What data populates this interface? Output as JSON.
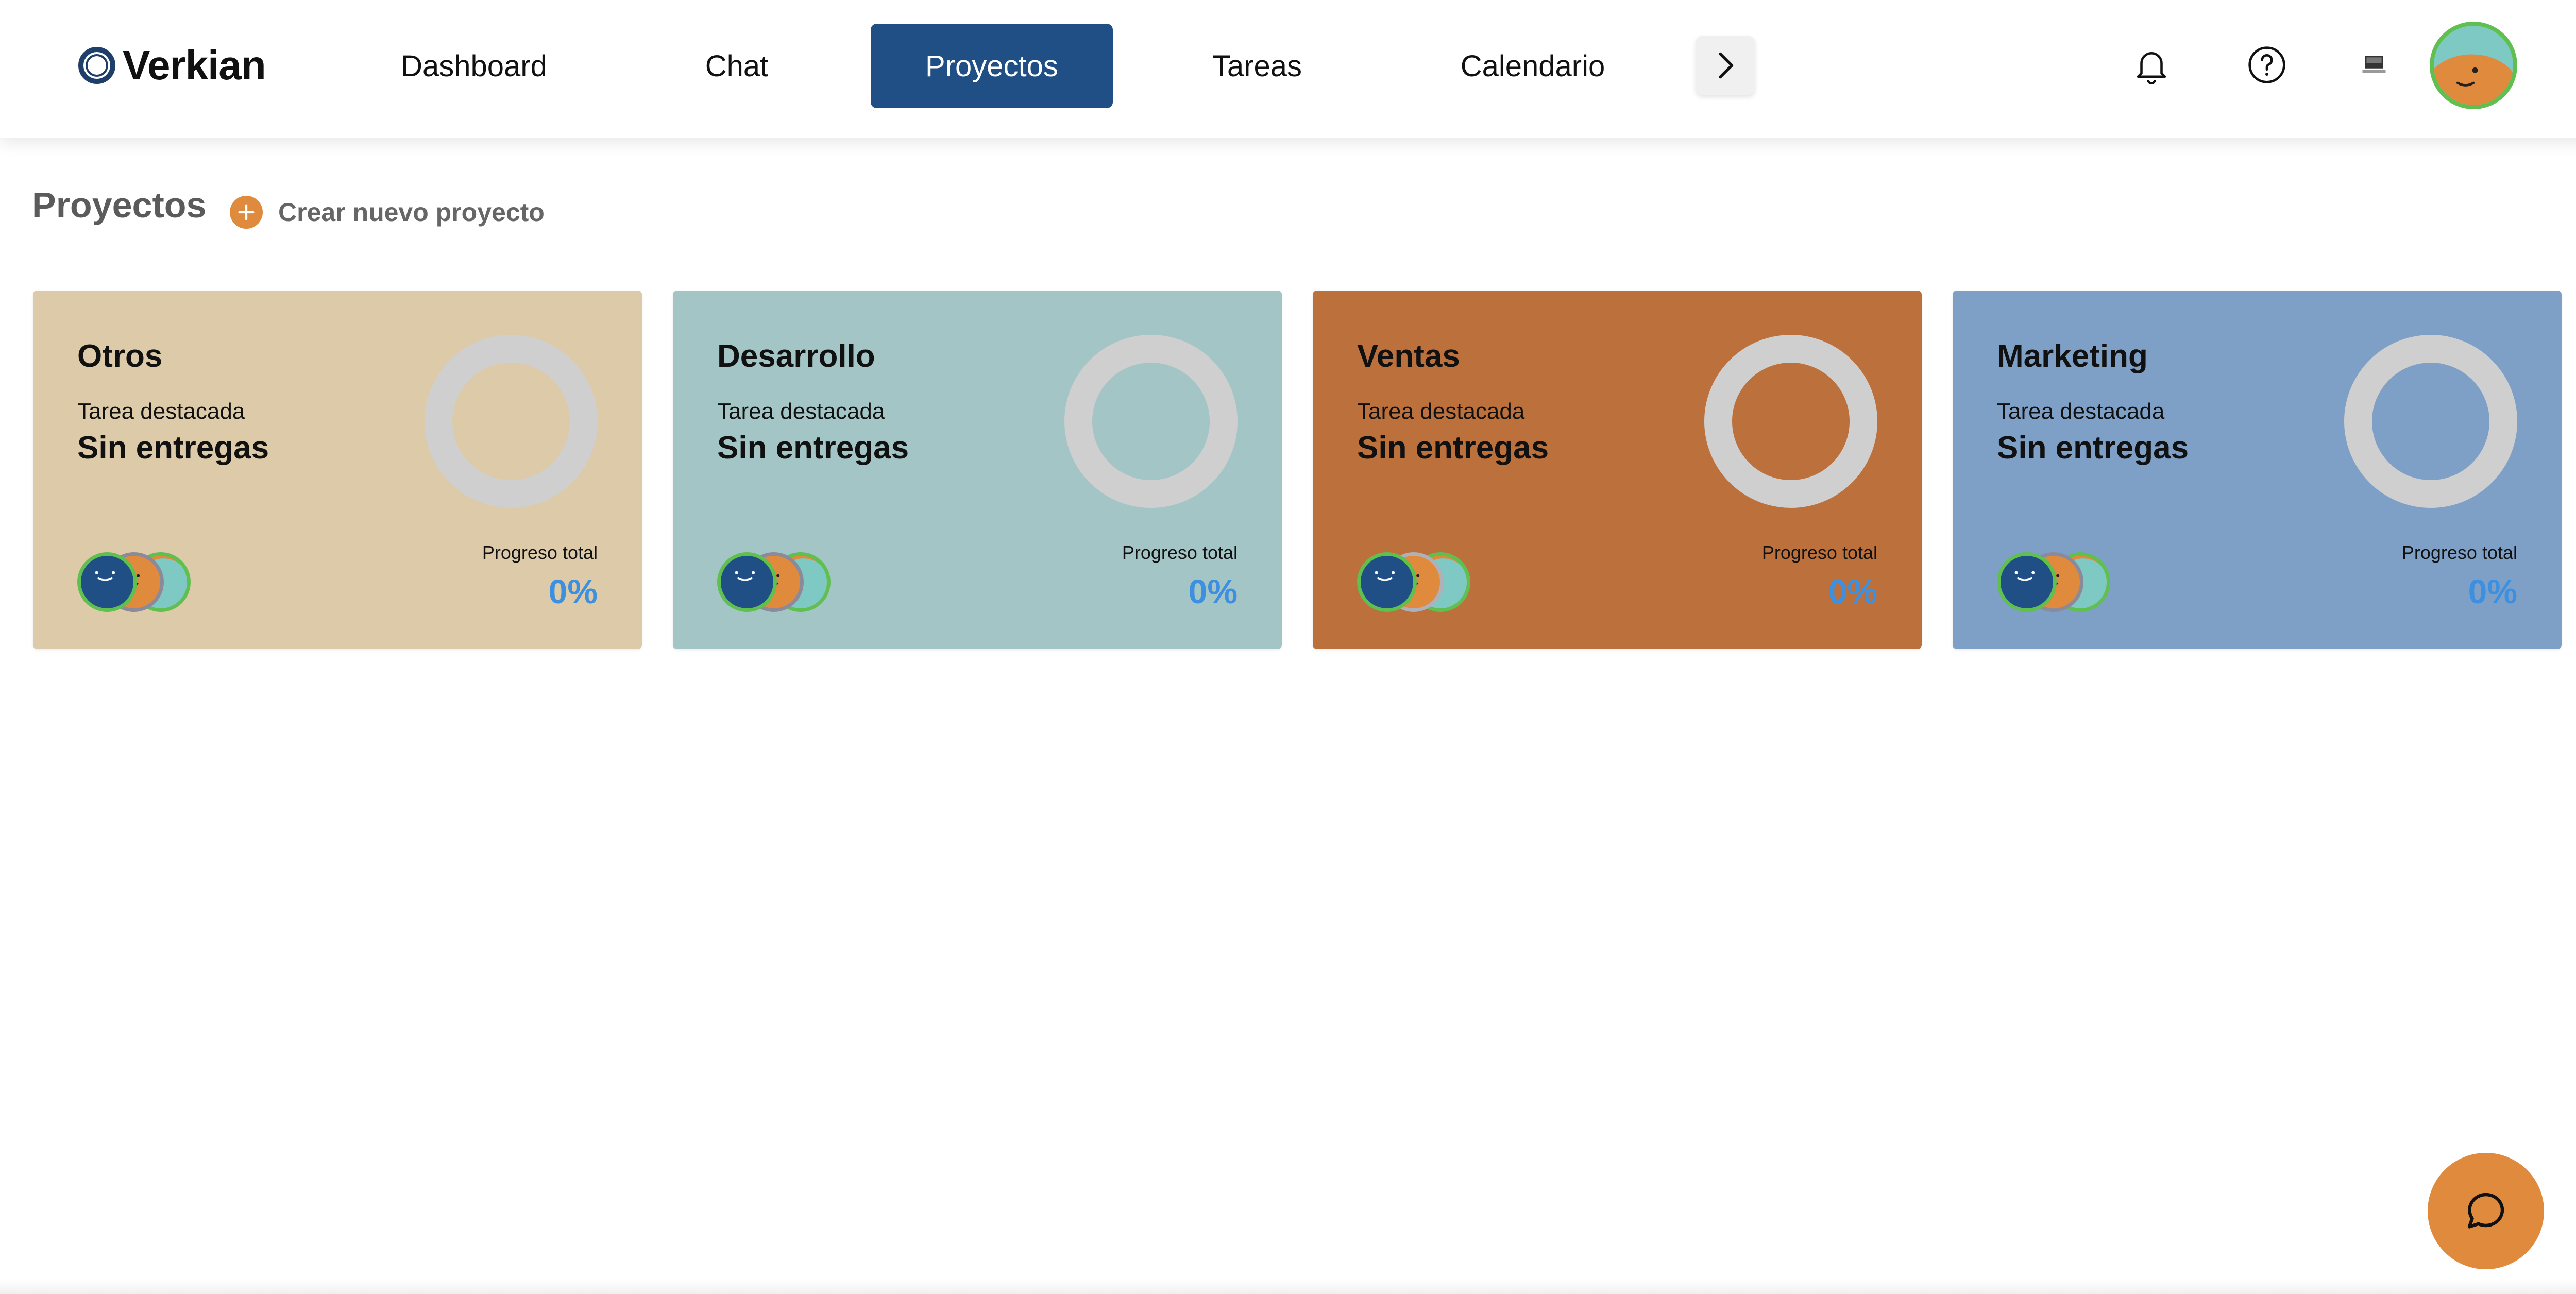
{
  "app": {
    "name": "Verkian"
  },
  "nav": {
    "items": [
      {
        "label": "Dashboard",
        "active": false
      },
      {
        "label": "Chat",
        "active": false
      },
      {
        "label": "Proyectos",
        "active": true
      },
      {
        "label": "Tareas",
        "active": false
      },
      {
        "label": "Calendario",
        "active": false
      }
    ],
    "more_icon": "chevron-right-icon"
  },
  "header_icons": [
    "bell-icon",
    "help-icon",
    "laptop-icon",
    "user-avatar"
  ],
  "page": {
    "title": "Proyectos",
    "create_label": "Crear nuevo proyecto"
  },
  "projects": [
    {
      "name": "Otros",
      "subtitle": "Tarea destacada",
      "task": "Sin entregas",
      "progress_label": "Progreso total",
      "progress": "0%",
      "color": "#dccaa8"
    },
    {
      "name": "Desarrollo",
      "subtitle": "Tarea destacada",
      "task": "Sin entregas",
      "progress_label": "Progreso total",
      "progress": "0%",
      "color": "#a4c5c5"
    },
    {
      "name": "Ventas",
      "subtitle": "Tarea destacada",
      "task": "Sin entregas",
      "progress_label": "Progreso total",
      "progress": "0%",
      "color": "#bc703c"
    },
    {
      "name": "Marketing",
      "subtitle": "Tarea destacada",
      "task": "Sin entregas",
      "progress_label": "Progreso total",
      "progress": "0%",
      "color": "#7fa0c6"
    }
  ],
  "colors": {
    "accent_blue": "#1f4f85",
    "accent_orange": "#e08a3e",
    "progress_blue": "#3d8fe0",
    "donut_gray": "#cfcfcf"
  },
  "fab_icon": "chat-bubble-icon"
}
